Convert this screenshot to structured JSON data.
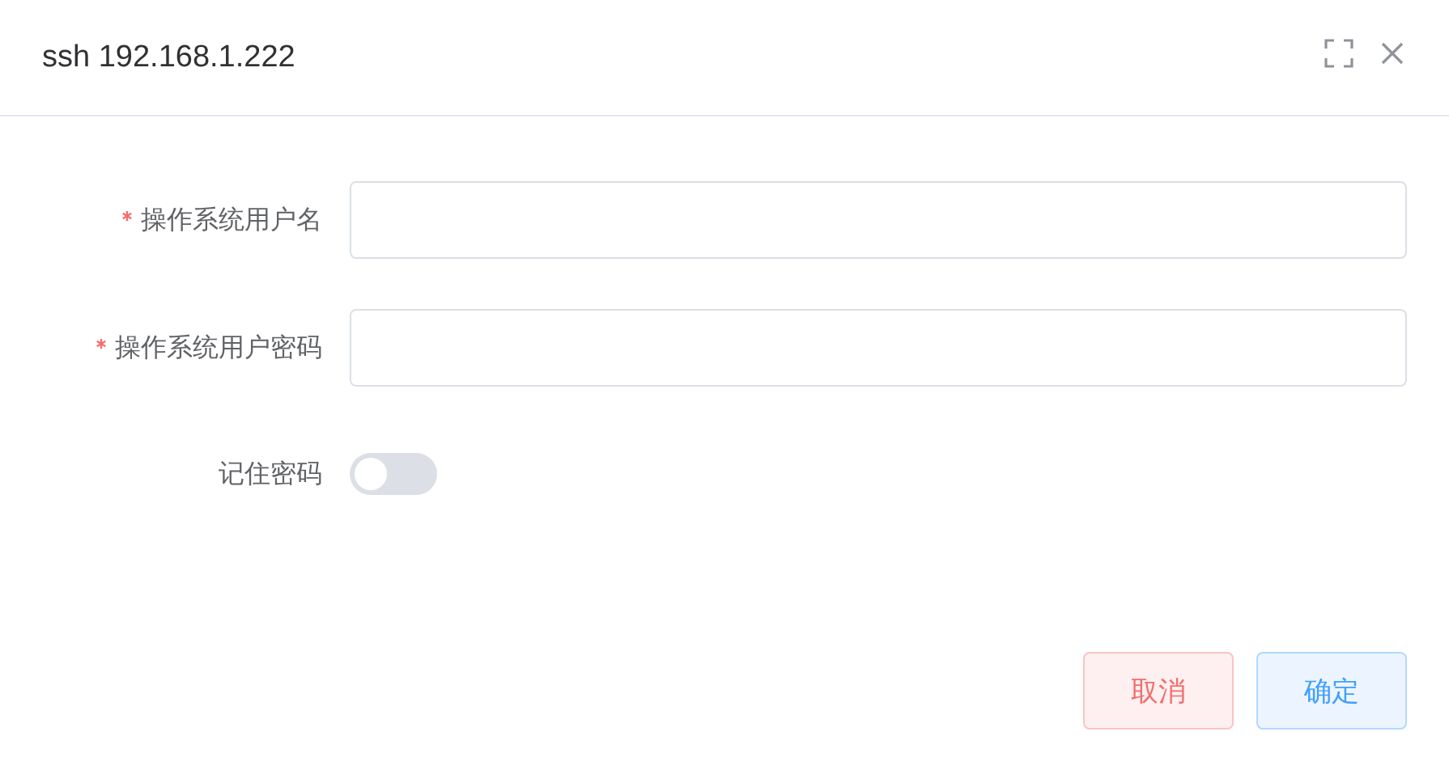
{
  "window": {
    "title": "ssh 192.168.1.222"
  },
  "form": {
    "rows": [
      {
        "kind": "input",
        "label": "操作系统用户名",
        "required": true
      },
      {
        "kind": "input",
        "label": "操作系统用户密码",
        "required": true
      },
      {
        "kind": "switch",
        "label": "记住密码",
        "required": false,
        "on": false
      }
    ]
  },
  "buttons": [
    {
      "kind": "cancel",
      "label": "取消"
    },
    {
      "kind": "confirm",
      "label": "确定"
    }
  ]
}
